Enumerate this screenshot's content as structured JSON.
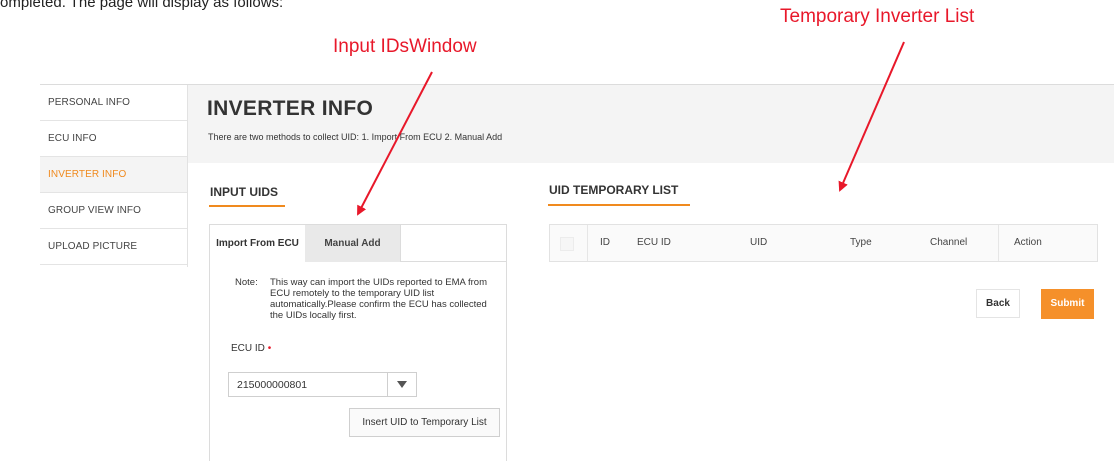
{
  "doc_caption": "ompleted. The page will display as follows:",
  "annotations": {
    "input_ids_window": "Input IDsWindow",
    "temporary_inverter_list": "Temporary Inverter List"
  },
  "colors": {
    "accent": "#f08a1e",
    "submit": "#f5902a",
    "annotation": "#e8182a"
  },
  "sidebar": {
    "items": [
      {
        "label": "PERSONAL INFO"
      },
      {
        "label": "ECU INFO"
      },
      {
        "label": "INVERTER INFO",
        "active": true
      },
      {
        "label": "GROUP VIEW INFO"
      },
      {
        "label": "UPLOAD PICTURE"
      }
    ]
  },
  "header": {
    "title": "INVERTER INFO",
    "subtitle": "There are two methods to collect UID: 1. Import From ECU 2. Manual Add"
  },
  "input_uids": {
    "title": "INPUT UIDS",
    "tabs": [
      {
        "label": "Import From ECU",
        "selected": true
      },
      {
        "label": "Manual Add",
        "selected": false
      }
    ],
    "note_label": "Note:",
    "note_text": "This way can import the UIDs reported to EMA from ECU remotely to the temporary UID list automatically.Please confirm the ECU has collected the UIDs locally first.",
    "ecu_id_label": "ECU ID",
    "required_mark": "•",
    "ecu_id_value": "215000000801",
    "insert_button": "Insert UID to Temporary List"
  },
  "uid_temp_list": {
    "title": "UID TEMPORARY LIST",
    "columns": [
      "ID",
      "ECU ID",
      "UID",
      "Type",
      "Channel",
      "Action"
    ],
    "rows": []
  },
  "actions": {
    "back": "Back",
    "submit": "Submit"
  }
}
